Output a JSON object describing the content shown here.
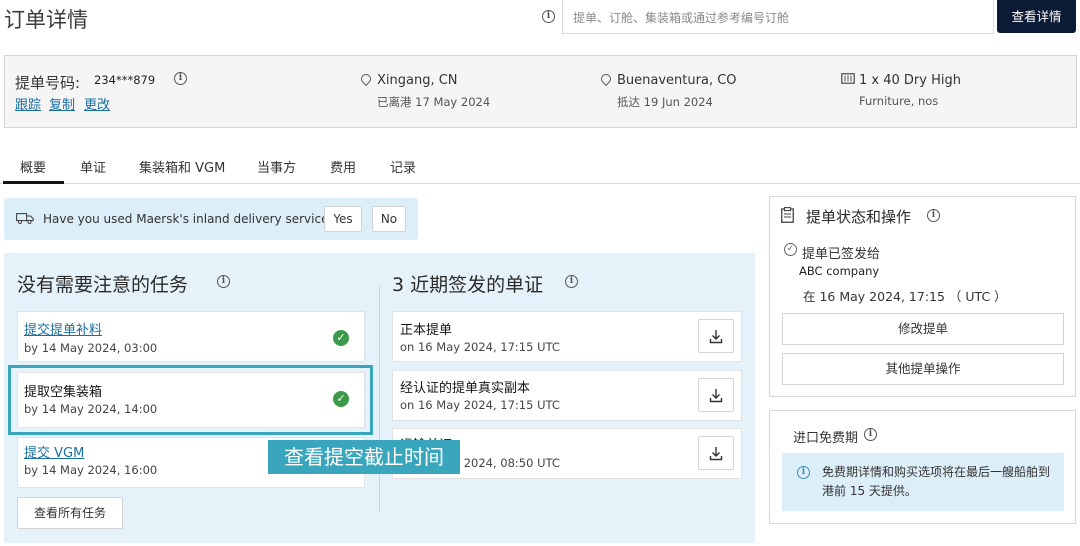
{
  "header": {
    "title": "订单详情",
    "search_placeholder": "提单、订舱、集装箱或通过参考编号订舱",
    "search_button": "查看详情"
  },
  "summary": {
    "bl_label": "提单号码:",
    "bl_number": "234***879",
    "links": [
      "跟踪",
      "复制",
      "更改"
    ],
    "origin": {
      "place": "Xingang, CN",
      "date": "已离港 17 May 2024"
    },
    "destination": {
      "place": "Buenaventura, CO",
      "date": "抵达 19 Jun 2024"
    },
    "container": {
      "type": "1 x 40 Dry High",
      "cargo": "Furniture, nos"
    }
  },
  "tabs": [
    "概要",
    "单证",
    "集装箱和 VGM",
    "当事方",
    "费用",
    "记录"
  ],
  "banner": {
    "text": "Have you used Maersk's inland delivery service?",
    "yes": "Yes",
    "no": "No"
  },
  "tasks": {
    "title": "没有需要注意的任务",
    "items": [
      {
        "title": "提交提单补料",
        "date": "by 14 May 2024, 03:00",
        "done": true,
        "link": true
      },
      {
        "title": "提取空集装箱",
        "date": "by 14 May 2024, 14:00",
        "done": true,
        "link": false
      },
      {
        "title": "提交 VGM",
        "date": "by 14 May 2024, 16:00",
        "done": false,
        "link": true
      }
    ],
    "view_all": "查看所有任务"
  },
  "documents": {
    "count": "3",
    "title": "近期签发的单证",
    "items": [
      {
        "title": "正本提单",
        "date": "on 16 May 2024, 17:15 UTC"
      },
      {
        "title": "经认证的提单真实副本",
        "date": "on 16 May 2024, 17:15 UTC"
      },
      {
        "title": "运输单证",
        "date": "on 14 May 2024, 08:50 UTC"
      }
    ]
  },
  "tooltip": "查看提空截止时间",
  "status_panel": {
    "title": "提单状态和操作",
    "status": "提单已签发给",
    "company": "ABC company",
    "time": "在 16 May 2024, 17:15 （ UTC ）",
    "buttons": [
      "修改提单",
      "其他提单操作"
    ]
  },
  "free_time": {
    "title": "进口免费期",
    "notice": "免费期详情和购买选项将在最后一艘船舶到港前 15 天提供。"
  },
  "colors": {
    "accent": "#3aa6bd",
    "navy": "#0b1b35",
    "link": "#1a6fa0",
    "success": "#3b9a4a",
    "panel": "#e6f2f9"
  }
}
